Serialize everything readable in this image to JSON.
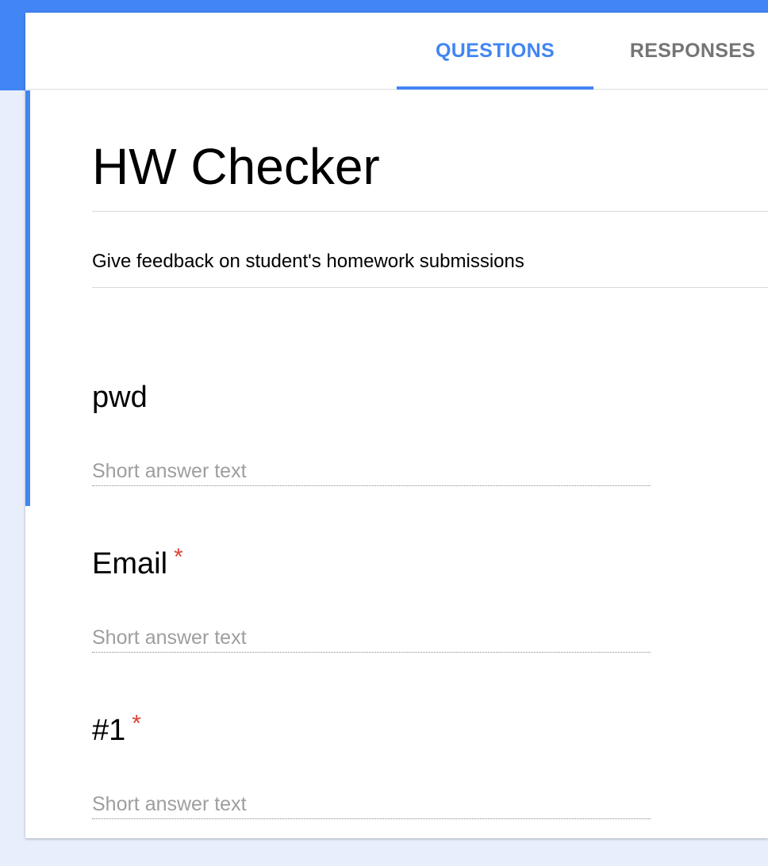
{
  "tabs": {
    "questions": "QUESTIONS",
    "responses": "RESPONSES"
  },
  "form": {
    "title": "HW Checker",
    "description": "Give feedback on student's homework submissions"
  },
  "questions": [
    {
      "title": "pwd",
      "required": false,
      "required_mark": "",
      "answer_placeholder": "Short answer text"
    },
    {
      "title": "Email",
      "required": true,
      "required_mark": "*",
      "answer_placeholder": "Short answer text"
    },
    {
      "title": "#1",
      "required": true,
      "required_mark": "*",
      "answer_placeholder": "Short answer text"
    }
  ],
  "colors": {
    "accent": "#4285f4",
    "background": "#e8eefb",
    "required": "#db4437",
    "inactive_tab": "#757575",
    "placeholder": "#9e9e9e"
  }
}
